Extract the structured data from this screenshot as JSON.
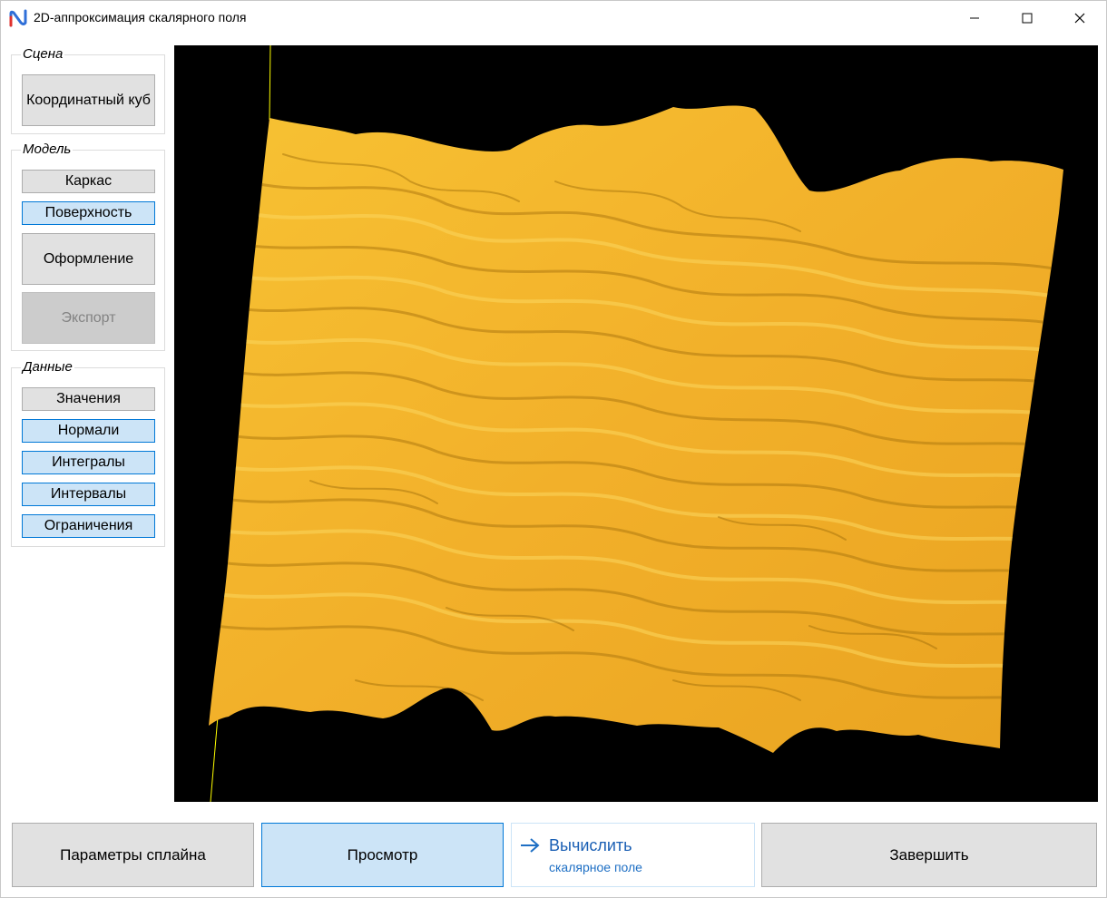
{
  "window": {
    "title": "2D-аппроксимация скалярного поля",
    "icon": "app-logo-icon",
    "controls": [
      "minimize-icon",
      "maximize-icon",
      "close-icon"
    ]
  },
  "sidebar": {
    "scene": {
      "legend": "Сцена",
      "buttons": [
        {
          "label": "Координатный куб",
          "state": "normal"
        }
      ]
    },
    "model": {
      "legend": "Модель",
      "buttons": [
        {
          "label": "Каркас",
          "state": "normal"
        },
        {
          "label": "Поверхность",
          "state": "checked"
        },
        {
          "label": "Оформление",
          "state": "normal"
        },
        {
          "label": "Экспорт",
          "state": "disabled"
        }
      ]
    },
    "data": {
      "legend": "Данные",
      "buttons": [
        {
          "label": "Значения",
          "state": "normal"
        },
        {
          "label": "Нормали",
          "state": "checked"
        },
        {
          "label": "Интегралы",
          "state": "checked"
        },
        {
          "label": "Интервалы",
          "state": "checked"
        },
        {
          "label": "Ограничения",
          "state": "checked"
        }
      ]
    }
  },
  "viewport": {
    "background": "#000000",
    "surface_color": "#f5b82e",
    "axis_color": "#ffff00"
  },
  "bottom": {
    "spline_params": "Параметры сплайна",
    "preview": "Просмотр",
    "compute_main": "Вычислить",
    "compute_sub": "скалярное поле",
    "finish": "Завершить"
  },
  "colors": {
    "checked_bg": "#cce4f7",
    "checked_border": "#0078d7",
    "link_text": "#1a5fb4"
  }
}
